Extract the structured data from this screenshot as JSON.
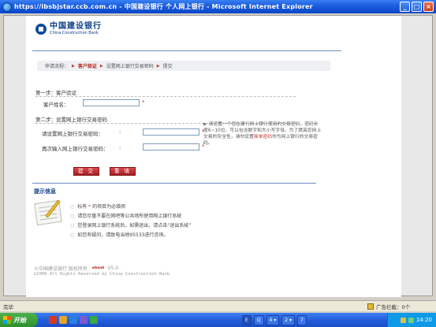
{
  "window": {
    "title": "https://ibsbjstar.ccb.com.cn - 中国建设银行 个人网上银行 - Microsoft Internet Explorer",
    "minimize": "_",
    "maximize": "□",
    "close": "×"
  },
  "logo": {
    "cn": "中国建设银行",
    "en": "China Construction Bank"
  },
  "breadcrumb": {
    "label": "申请流程：",
    "items": [
      "客户验证",
      "设置网上银行交易密码",
      "提交"
    ],
    "separator": "▶"
  },
  "step1": {
    "title": "第一步：客户验证",
    "name_label": "客户姓名："
  },
  "step2": {
    "title": "第二步：设置网上银行交易密码",
    "pwd_label": "请设置网上银行交易密码：",
    "pwd_confirm_label": "再次输入网上银行交易密码："
  },
  "required_mark": "*",
  "hint": {
    "arrow": "▶",
    "part1": "请设置一个您在建行网上银行使用的交易密码，密码长度6~10位，可以包含数字和大小写字母。为了提高您网上交易的安全性，请勿设置",
    "emphasis": "简单密码",
    "part2": "作为网上银行的交易密码。"
  },
  "buttons": {
    "submit": "提 交",
    "clear": "重 填"
  },
  "tips": {
    "title": "提示信息",
    "bullet": "○",
    "items": [
      {
        "pre": "标有 ",
        "mark": "*",
        "post": " 的项目为必填项"
      },
      {
        "pre": "请您尽量不要在网吧等公共场所使用网上银行系统",
        "mark": "",
        "post": ""
      },
      {
        "pre": "您登录网上银行系统后，如需退出，请点击“退出系统”",
        "mark": "",
        "post": ""
      },
      {
        "pre": "如您有疑问，请致电当地95533进行咨询。",
        "mark": "",
        "post": ""
      }
    ]
  },
  "footer": {
    "line1": "©中国建设银行 版权所有",
    "badge": "ebank",
    "version": "V5.0",
    "line2": "©2006 All Rights Reserved by China Construction Bank"
  },
  "status": {
    "text": "完毕",
    "popup": "广告拦截：0个"
  },
  "taskbar": {
    "start": "开始",
    "tasks": [
      "E",
      "Q",
      "4 ▾",
      "2 ▾",
      "7"
    ],
    "clock": "14:20"
  },
  "colors": {
    "accent": "#0b3f8a",
    "required": "#c0392b",
    "button": "#b3261e"
  }
}
